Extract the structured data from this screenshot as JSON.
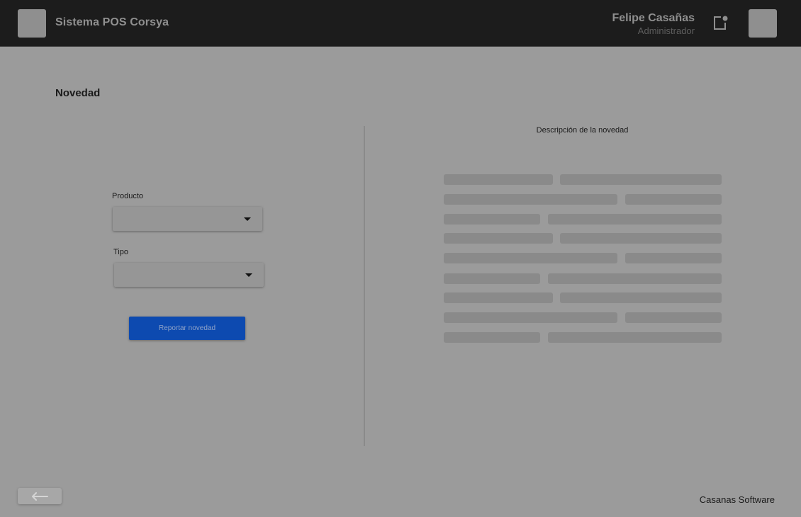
{
  "header": {
    "app_title": "Sistema POS Corsya",
    "user_name": "Felipe Casañas",
    "user_role": "Administrador",
    "logo_icon": "app-logo-placeholder",
    "notification_icon": "notification-icon",
    "avatar_icon": "avatar-placeholder"
  },
  "main": {
    "title": "Novedad",
    "form": {
      "producto_label": "Producto",
      "producto_value": "",
      "tipo_label": "Tipo",
      "tipo_value": "",
      "submit_label": "Reportar novedad"
    },
    "description": {
      "title": "Descripción de la novedad",
      "state": "loading-skeleton"
    }
  },
  "footer": {
    "back_icon": "arrow-left-icon",
    "brand": "Casanas Software"
  },
  "colors": {
    "header_bg": "#1c1c1c",
    "page_bg": "#9b9b9b",
    "primary_button": "#0d4ab0"
  }
}
